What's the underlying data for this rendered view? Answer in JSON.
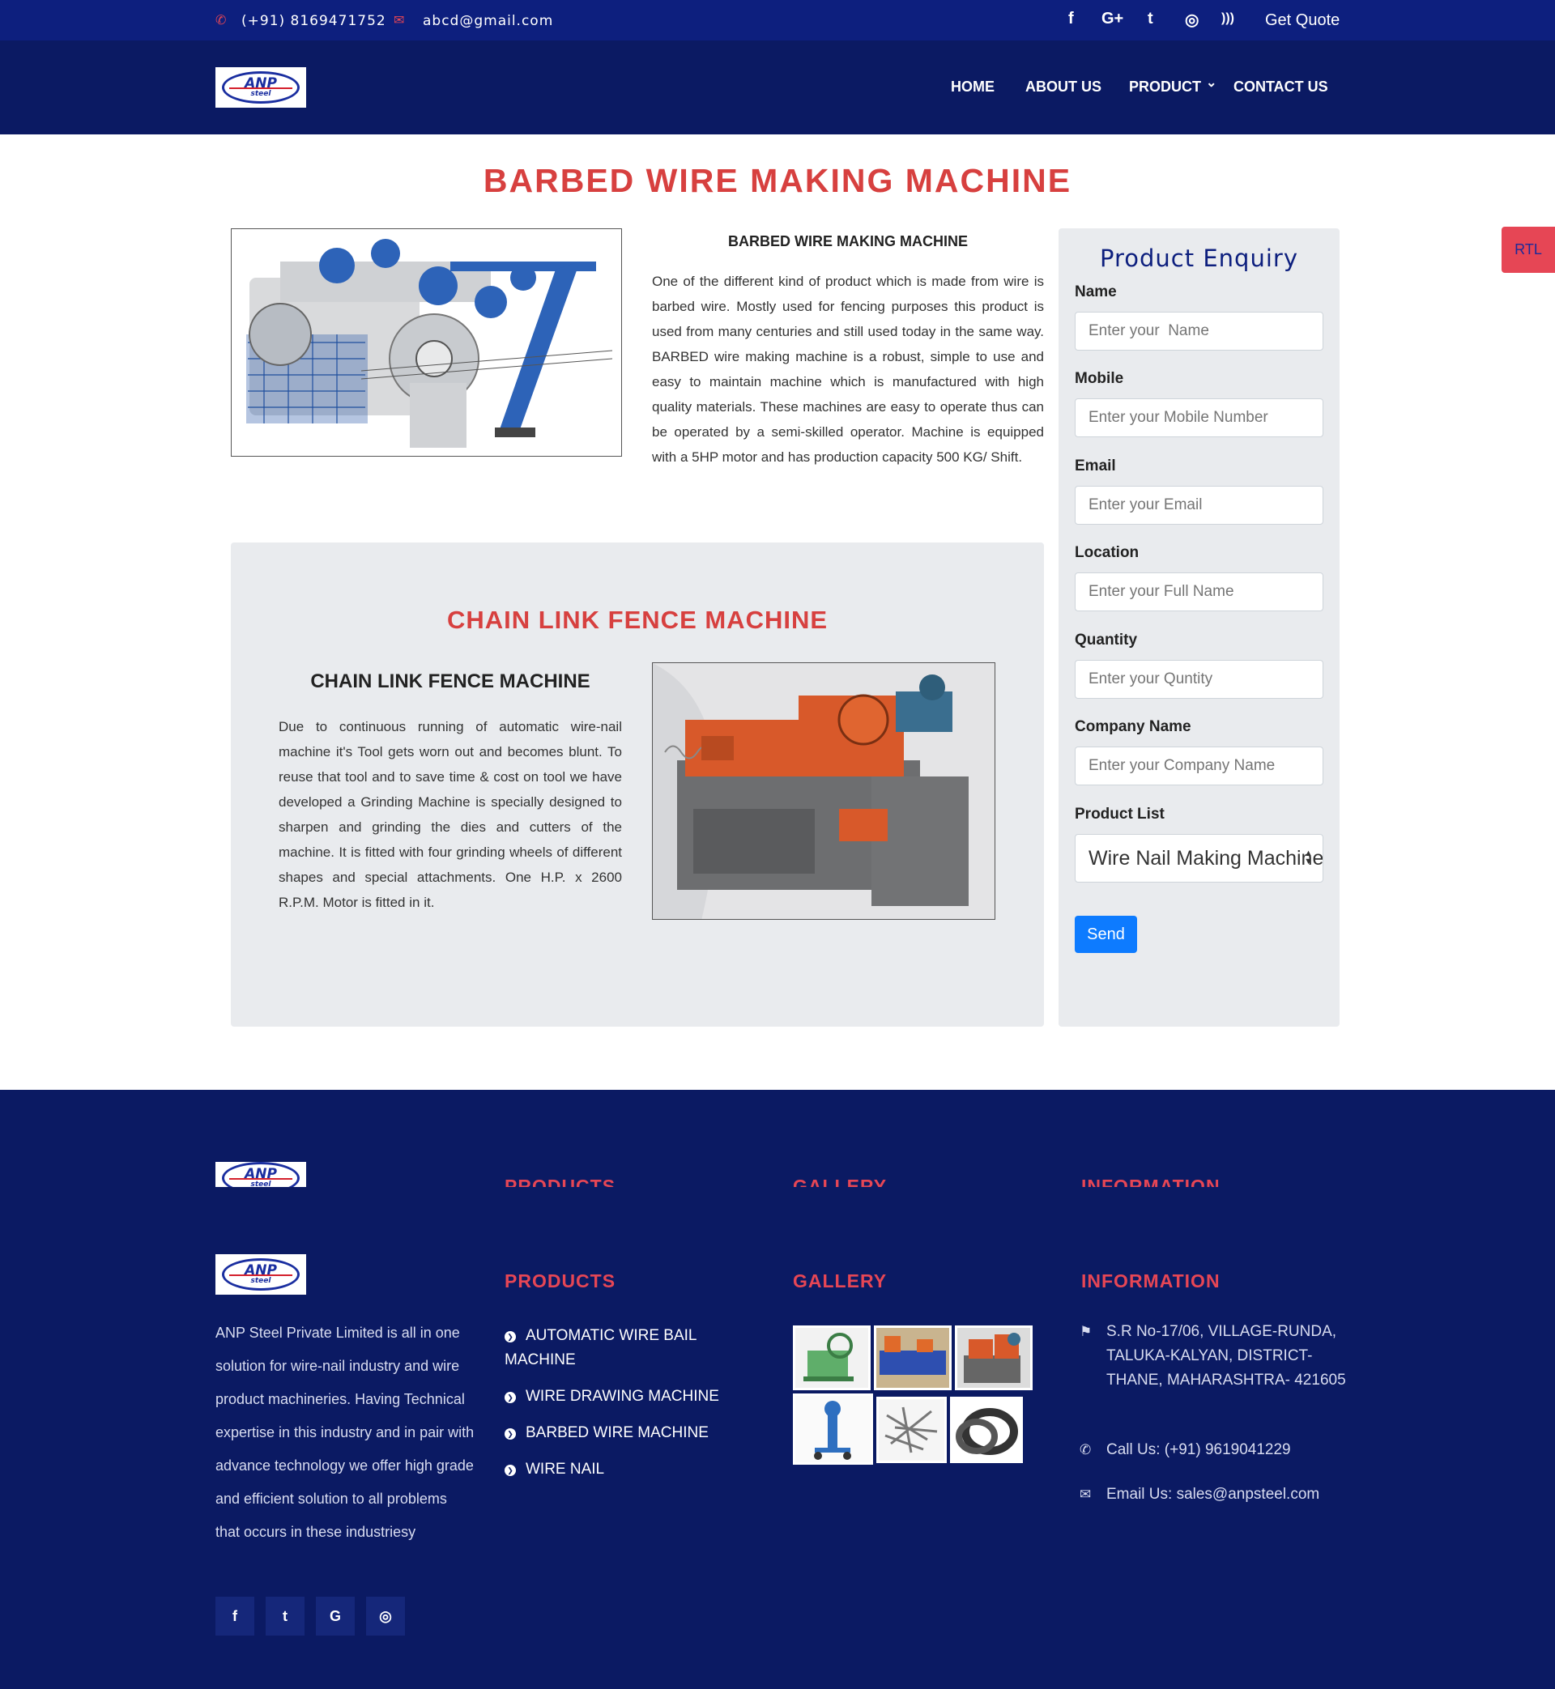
{
  "topbar": {
    "phone": "(+91) 8169471752",
    "email": "abcd@gmail.com",
    "social_icons": [
      "facebook-icon",
      "google-plus-icon",
      "twitter-icon",
      "instagram-icon",
      "rss-icon"
    ],
    "social_glyphs": [
      "f",
      "G+",
      "t",
      "◎",
      ")))"
    ],
    "get_quote": "Get Quote"
  },
  "nav": {
    "logo_text": "ANP",
    "logo_sub": "steel",
    "items": [
      "HOME",
      "ABOUT US",
      "PRODUCT",
      "CONTACT US"
    ],
    "product_caret": "⌄"
  },
  "rtl_label": "RTL",
  "main": {
    "page_title": "BARBED WIRE MAKING MACHINE",
    "barbed": {
      "subtitle": "BARBED WIRE MAKING MACHINE",
      "description": "One of the different kind of product which is made from wire is barbed wire. Mostly used for fencing purposes this product is used from many centuries and still used today in the same way. BARBED wire making machine is a robust, simple to use and easy to maintain machine which is manufactured with high quality materials. These machines are easy to operate thus can be operated by a semi-skilled operator. Machine is equipped with a 5HP motor and has production capacity 500 KG/ Shift."
    },
    "chain_link": {
      "section_title": "CHAIN LINK FENCE MACHINE",
      "subtitle": "CHAIN LINK FENCE MACHINE",
      "description": "Due to continuous running of automatic wire-nail machine it's Tool gets worn out and becomes blunt. To reuse that tool and to save time & cost on tool we have developed a Grinding Machine is specially designed to sharpen and grinding the dies and cutters of the machine. It is fitted with four grinding wheels of different shapes and special attachments. One H.P. x 2600 R.P.M. Motor is fitted in it."
    }
  },
  "enquiry": {
    "title": "Product Enquiry",
    "fields": [
      {
        "label": "Name",
        "placeholder": "Enter your  Name"
      },
      {
        "label": "Mobile",
        "placeholder": "Enter your Mobile Number"
      },
      {
        "label": "Email",
        "placeholder": "Enter your Email"
      },
      {
        "label": "Location",
        "placeholder": "Enter your Full Name"
      },
      {
        "label": "Quantity",
        "placeholder": "Enter your Quntity"
      },
      {
        "label": "Company Name",
        "placeholder": "Enter your Company Name"
      }
    ],
    "product_list_label": "Product List",
    "product_list_value": "Wire Nail Making Machine",
    "send_label": "Send"
  },
  "footer": {
    "ghost_titles": [
      "PRODUCTS",
      "GALLERY",
      "INFORMATION"
    ],
    "about": "ANP Steel Private Limited is all in one solution for wire-nail industry and wire product machineries. Having Technical expertise in this industry and in pair with advance technology we offer high grade and efficient solution to all problems that occurs in these industriesy",
    "products_title": "PRODUCTS",
    "products": [
      "AUTOMATIC WIRE BAIL MACHINE",
      "WIRE DRAWING MACHINE",
      "BARBED WIRE MACHINE",
      "WIRE NAIL"
    ],
    "gallery_title": "GALLERY",
    "information_title": "INFORMATION",
    "address": "S.R No-17/06, VILLAGE-RUNDA, TALUKA-KALYAN, DISTRICT-THANE, MAHARASHTRA- 421605",
    "call": "Call Us: (+91) 9619041229",
    "email": "Email Us: sales@anpsteel.com",
    "social_icons": [
      "facebook-icon",
      "twitter-icon",
      "google-icon",
      "instagram-icon"
    ],
    "social_glyphs": [
      "f",
      "t",
      "G",
      "◎"
    ]
  },
  "colors": {
    "navy": "#0b1a63",
    "topbar": "#0d1f7e",
    "accent_red": "#d7403f",
    "button_blue": "#0d7bff"
  }
}
